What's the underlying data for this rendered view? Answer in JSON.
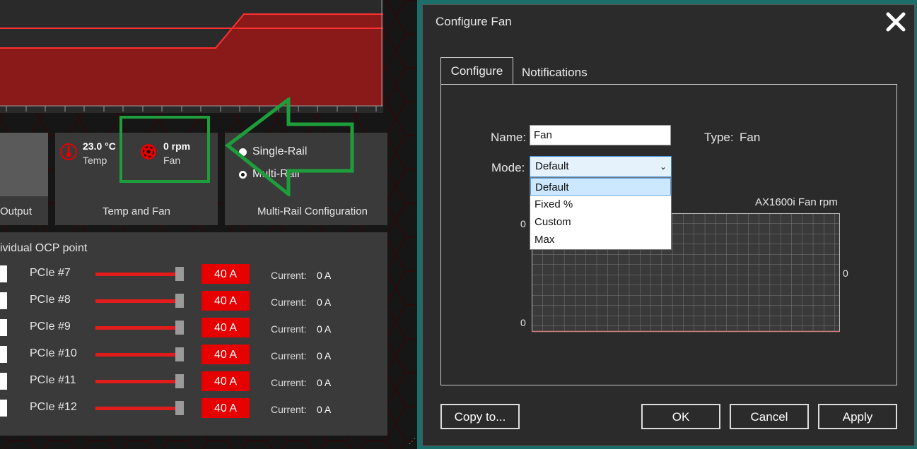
{
  "colors": {
    "accent_red": "#e60000",
    "highlight_green": "#1e9e3a",
    "dialog_bg": "#2b2b2b",
    "tile_bg": "#3a3a3a"
  },
  "background_app": {
    "stats": {
      "output_caption": "Output",
      "temp_value": "23.0 °C",
      "temp_label": "Temp",
      "fan_value": "0 rpm",
      "fan_label": "Fan",
      "temp_fan_caption": "Temp and Fan",
      "temp_icon": "thermometer-icon",
      "fan_icon": "fan-icon"
    },
    "rail_config": {
      "caption": "Multi-Rail Configuration",
      "options": [
        "Single-Rail",
        "Multi-Rail"
      ],
      "selected": "Single-Rail"
    },
    "ocp": {
      "title": "ividual OCP point",
      "current_label": "Current:",
      "rows": [
        {
          "name": "PCIe #7",
          "limit": "40 A",
          "current": "0 A"
        },
        {
          "name": "PCIe #8",
          "limit": "40 A",
          "current": "0 A"
        },
        {
          "name": "PCIe #9",
          "limit": "40 A",
          "current": "0 A"
        },
        {
          "name": "PCIe #10",
          "limit": "40 A",
          "current": "0 A"
        },
        {
          "name": "PCIe #11",
          "limit": "40 A",
          "current": "0 A"
        },
        {
          "name": "PCIe #12",
          "limit": "40 A",
          "current": "0 A"
        }
      ]
    }
  },
  "dialog": {
    "title": "Configure Fan",
    "close_icon": "close-icon",
    "tabs": [
      "Configure",
      "Notifications"
    ],
    "active_tab": "Configure",
    "name_label": "Name:",
    "name_value": "Fan",
    "type_label": "Type:",
    "type_value": "Fan",
    "mode_label": "Mode:",
    "mode_value": "Default",
    "mode_options": [
      "Default",
      "Fixed %",
      "Custom",
      "Max"
    ],
    "chart": {
      "title": "AX1600i  Fan  rpm",
      "y_top": "0",
      "y_bottom": "0",
      "right_value": "0"
    },
    "buttons": {
      "copy": "Copy to...",
      "ok": "OK",
      "cancel": "Cancel",
      "apply": "Apply"
    }
  }
}
